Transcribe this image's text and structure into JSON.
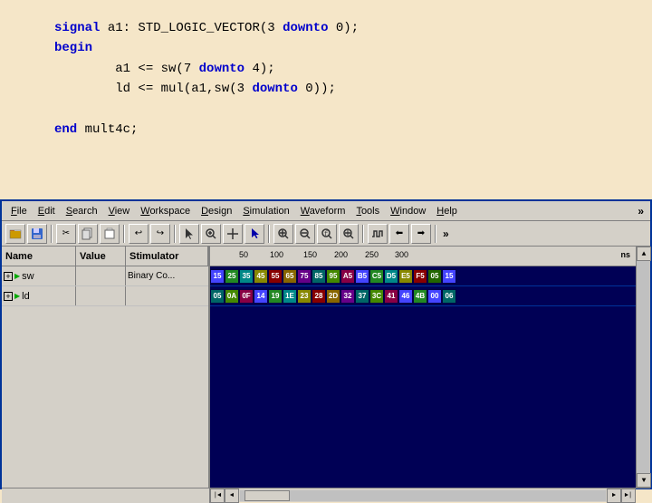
{
  "code": {
    "line1": "signal  a1:  STD_LOGIC_VECTOR(3 downto 0);",
    "line2": "begin",
    "line3": "        a1 <= sw(7 downto 4);",
    "line4": "        ld <= mul(a1,sw(3 downto 0));",
    "line5": "",
    "line6": "end mult4c;"
  },
  "menu": {
    "items": [
      {
        "label": "File",
        "underline": "F"
      },
      {
        "label": "Edit",
        "underline": "E"
      },
      {
        "label": "Search",
        "underline": "S"
      },
      {
        "label": "View",
        "underline": "V"
      },
      {
        "label": "Workspace",
        "underline": "W"
      },
      {
        "label": "Design",
        "underline": "D"
      },
      {
        "label": "Simulation",
        "underline": "S"
      },
      {
        "label": "Waveform",
        "underline": "W"
      },
      {
        "label": "Tools",
        "underline": "T"
      },
      {
        "label": "Window",
        "underline": "W"
      },
      {
        "label": "Help",
        "underline": "H"
      }
    ],
    "chevron": "»"
  },
  "signal_columns": {
    "name": "Name",
    "value": "Value",
    "stimulator": "Stimulator"
  },
  "signals": [
    {
      "name": "sw",
      "value": "",
      "stimulator": "Binary Co...",
      "wave_colors": [
        "blue",
        "green",
        "cyan",
        "yellow",
        "red",
        "orange",
        "purple",
        "teal",
        "lime",
        "pink",
        "blue",
        "green",
        "cyan",
        "yellow",
        "red",
        "orange"
      ]
    },
    {
      "name": "ld",
      "value": "",
      "stimulator": "",
      "wave_colors": [
        "teal",
        "lime",
        "pink",
        "blue",
        "green",
        "cyan",
        "yellow",
        "red",
        "orange",
        "purple",
        "teal",
        "lime",
        "pink",
        "blue",
        "green",
        "cyan"
      ]
    }
  ],
  "wave_data": {
    "sw_values": [
      "15",
      "25",
      "35",
      "45",
      "55",
      "65",
      "75",
      "85",
      "95",
      "A5",
      "B5",
      "C5",
      "D5",
      "E5",
      "F5",
      "05",
      "15"
    ],
    "ld_values": [
      "05",
      "0A",
      "0F",
      "14",
      "19",
      "1E",
      "23",
      "28",
      "2D",
      "32",
      "37",
      "3C",
      "41",
      "46",
      "4B",
      "00",
      "06"
    ],
    "ruler_marks": [
      "50",
      "100",
      "150",
      "200",
      "250",
      "300"
    ],
    "ruler_unit": "ns"
  },
  "toolbar": {
    "chevron_right": "»"
  },
  "scrollbar": {
    "left_arrow": "◄",
    "right_arrow": "►",
    "up_arrow": "▲",
    "down_arrow": "▼",
    "left_end": "|◄",
    "right_end": "►|"
  }
}
